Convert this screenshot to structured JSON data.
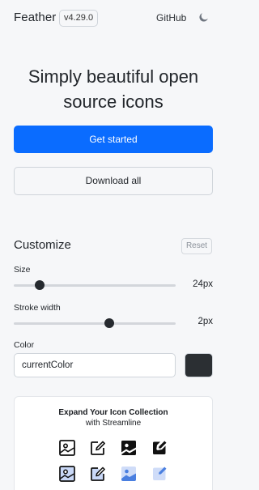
{
  "header": {
    "brand": "Feather",
    "version": "v4.29.0",
    "github_label": "GitHub",
    "theme_toggle_icon": "moon-icon"
  },
  "hero": {
    "title_line1": "Simply beautiful open",
    "title_line2": "source icons",
    "primary_label": "Get started",
    "secondary_label": "Download all"
  },
  "customize": {
    "title": "Customize",
    "reset_label": "Reset",
    "size": {
      "label": "Size",
      "value": "24px",
      "level": 0.16
    },
    "stroke": {
      "label": "Stroke width",
      "value": "2px",
      "level": 0.59
    },
    "color": {
      "label": "Color",
      "value": "currentColor",
      "swatch": "#2b2f33"
    }
  },
  "promo": {
    "title": "Expand Your Icon Collection",
    "subtitle": "with Streamline",
    "icons_row1": [
      "image-outline-icon",
      "edit-outline-icon",
      "image-solid-icon",
      "edit-solid-icon"
    ],
    "icons_row2": [
      "image-duotone-icon",
      "edit-duotone-icon",
      "image-flat-icon",
      "edit-flat-icon"
    ]
  },
  "colors": {
    "accent": "#0a6cff",
    "background": "#f6f7f9",
    "slider_thumb": "#262a2f",
    "promo_accent": "#4a7fe0"
  }
}
